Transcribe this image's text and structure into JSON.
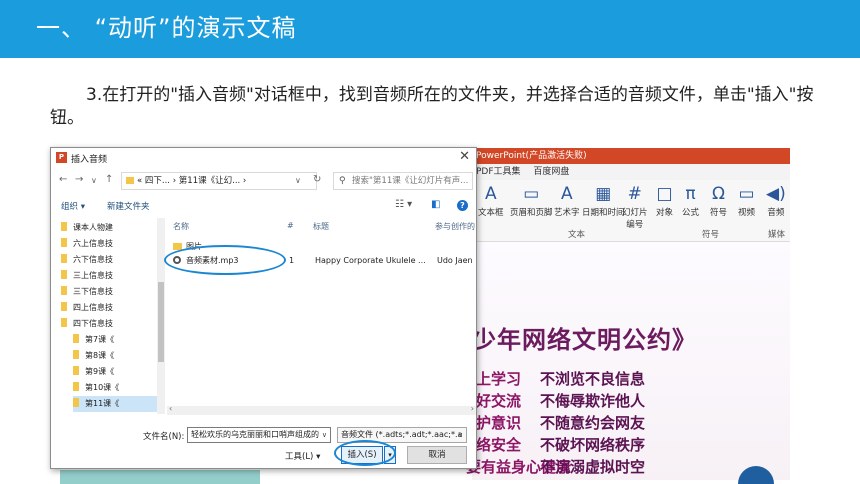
{
  "header": {
    "title": "一、  “动听”的演示文稿"
  },
  "instruction": "3.在打开的\"插入音频\"对话框中，找到音频所在的文件夹，并选择合适的音频文件，单击\"插入\"按钮。",
  "ppt": {
    "titlebar": "PowerPoint(产品激活失败)",
    "tabs": [
      "PDF工具集",
      "百度网盘"
    ],
    "ribbon": [
      {
        "label": "文本框",
        "icon": "A"
      },
      {
        "label": "页眉和页脚",
        "icon": "▭"
      },
      {
        "label": "艺术字",
        "icon": "A"
      },
      {
        "label": "日期和时间",
        "icon": "▦"
      },
      {
        "label": "幻灯片\n编号",
        "icon": "#"
      },
      {
        "label": "对象",
        "icon": "□"
      },
      {
        "label": "公式",
        "icon": "π"
      },
      {
        "label": "符号",
        "icon": "Ω"
      },
      {
        "label": "视频",
        "icon": "▭"
      },
      {
        "label": "音频",
        "icon": "◀)"
      }
    ],
    "groups": [
      "文本",
      "符号",
      "媒体"
    ],
    "convention_title": "少年网络文明公约》",
    "rules_left": [
      "上学习",
      "好交流",
      "护意识",
      "络安全",
      "要有益身心健康"
    ],
    "rules_right": [
      "不浏览不良信息",
      "不侮辱欺诈他人",
      "不随意约会网友",
      "不破坏网络秩序",
      "不沉溺虚拟时空"
    ]
  },
  "dialog": {
    "title": "插入音频",
    "close": "✕",
    "address": "« 四下... › 第11课《让幻... ›",
    "search_placeholder": "搜索\"第11课《让幻灯片有声...",
    "organize": "组织 ▾",
    "new_folder": "新建文件夹",
    "tree": [
      "课本人物建",
      "六上信息技",
      "六下信息技",
      "三上信息技",
      "三下信息技",
      "四上信息技",
      "四下信息技",
      "第7课《",
      "第8课《",
      "第9课《",
      "第10课《",
      "第11课《"
    ],
    "columns": {
      "name": "名称",
      "number": "#",
      "title": "标题",
      "artist": "参与创作的"
    },
    "files": [
      {
        "name": "图片",
        "number": "",
        "title": "",
        "artist": ""
      },
      {
        "name": "音频素材.mp3",
        "number": "1",
        "title": "Happy Corporate Ukulele ...",
        "artist": "Udo Jaen"
      }
    ],
    "filename_label": "文件名(N):",
    "filename_value": "轻松欢乐的乌克丽丽和口哨声组成的",
    "filter_value": "音频文件 (*.adts;*.adt;*.aac;*.a",
    "tools": "工具(L)  ▾",
    "insert": "插入(S)",
    "split": "▾",
    "cancel": "取消"
  }
}
